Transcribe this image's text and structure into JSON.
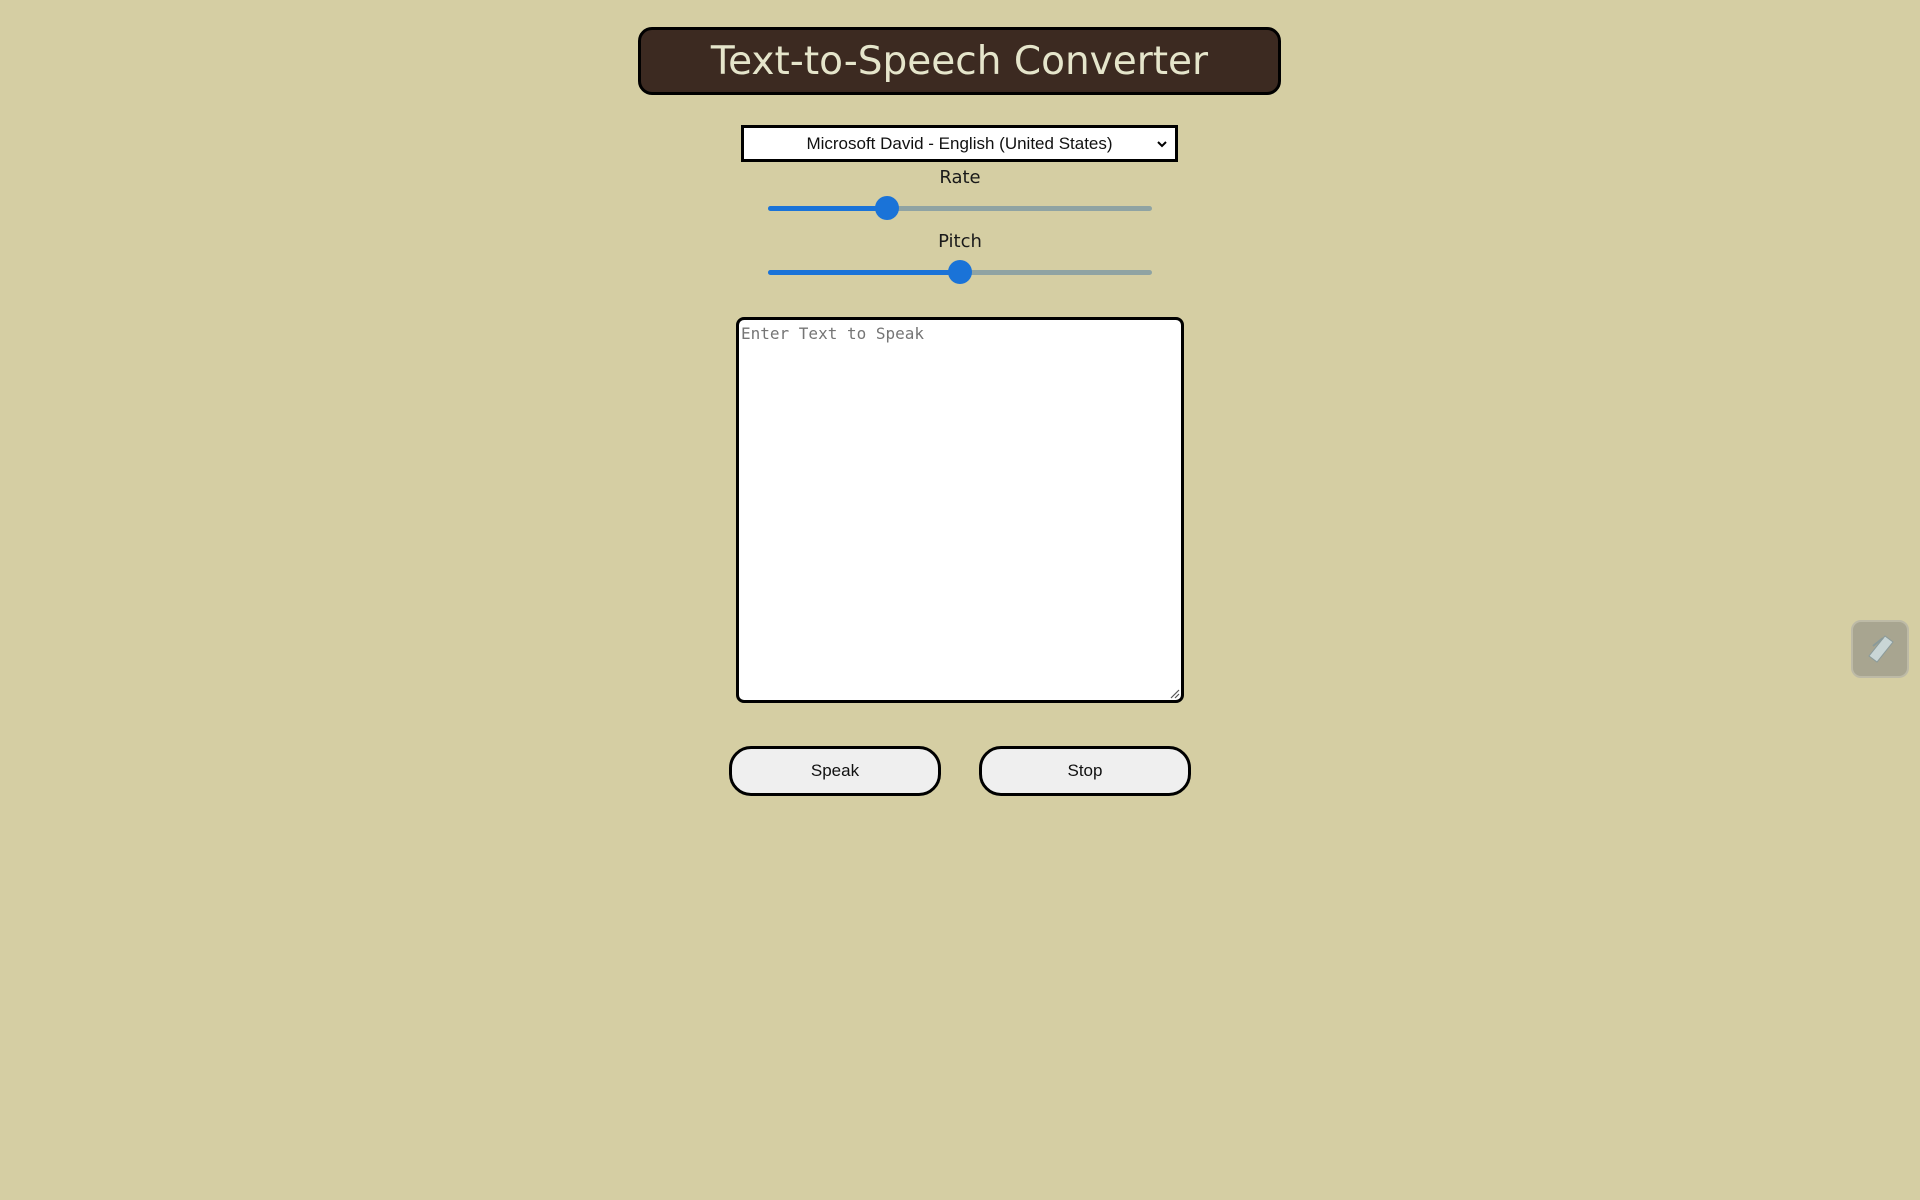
{
  "header": {
    "title": "Text-to-Speech Converter"
  },
  "voice": {
    "selected": "Microsoft David - English (United States)"
  },
  "controls": {
    "rate": {
      "label": "Rate",
      "value": 1,
      "min": 0.1,
      "max": 3
    },
    "pitch": {
      "label": "Pitch",
      "value": 1,
      "min": 0,
      "max": 2
    }
  },
  "input": {
    "value": "",
    "placeholder": "Enter Text to Speak"
  },
  "buttons": {
    "speak_label": "Speak",
    "stop_label": "Stop"
  },
  "icons": {
    "dropdown": "chevron-down-icon",
    "resize": "resize-grip-icon",
    "extension": "extension-pen-icon"
  },
  "colors": {
    "background": "#d5cea3",
    "header_bg": "#3c2a21",
    "header_text": "#e5e5cb",
    "slider_accent": "#1a73d8",
    "button_bg": "#efefef"
  }
}
